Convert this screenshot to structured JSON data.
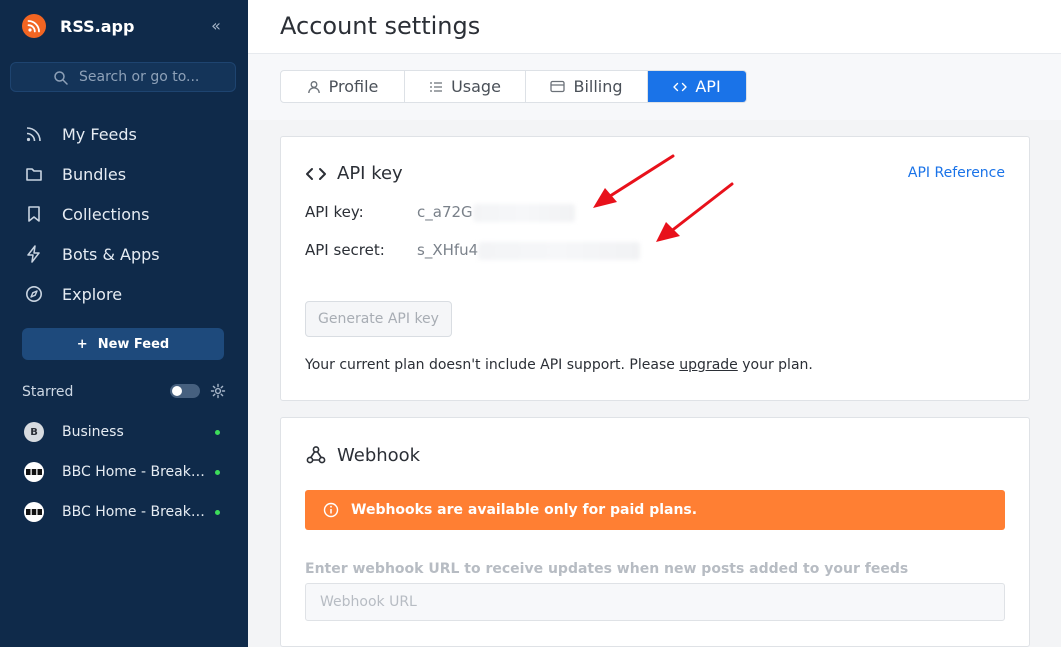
{
  "sidebar": {
    "brand": "RSS.app",
    "search_placeholder": "Search or go to...",
    "nav": [
      {
        "label": "My Feeds",
        "icon": "rss-icon"
      },
      {
        "label": "Bundles",
        "icon": "folder-icon"
      },
      {
        "label": "Collections",
        "icon": "bookmark-icon"
      },
      {
        "label": "Bots & Apps",
        "icon": "bolt-icon"
      },
      {
        "label": "Explore",
        "icon": "compass-icon"
      }
    ],
    "new_feed_label": "New Feed",
    "starred_label": "Starred",
    "feeds": [
      {
        "label": "Business",
        "avatar": "B"
      },
      {
        "label": "BBC Home - Breaking News",
        "avatar": "BBC"
      },
      {
        "label": "BBC Home - Breaking News",
        "avatar": "BBC"
      }
    ]
  },
  "header": {
    "title": "Account settings"
  },
  "tabs": [
    {
      "label": "Profile",
      "icon": "user-icon"
    },
    {
      "label": "Usage",
      "icon": "list-icon"
    },
    {
      "label": "Billing",
      "icon": "card-icon"
    },
    {
      "label": "API",
      "icon": "code-icon",
      "active": true
    }
  ],
  "api_card": {
    "title": "API key",
    "reference_link": "API Reference",
    "key_label": "API key:",
    "key_value": "c_a72G",
    "secret_label": "API secret:",
    "secret_value": "s_XHfu4",
    "generate_button": "Generate API key",
    "plan_note_before": "Your current plan doesn't include API support. Please ",
    "plan_note_link": "upgrade",
    "plan_note_after": " your plan."
  },
  "webhook_card": {
    "title": "Webhook",
    "alert": "Webhooks are available only for paid plans.",
    "input_label": "Enter webhook URL to receive updates when new posts added to your feeds",
    "input_placeholder": "Webhook URL"
  },
  "colors": {
    "sidebar_bg": "#0f2a4a",
    "accent": "#1a73e8",
    "alert": "#ff7f33",
    "brand": "#f26522",
    "annotation_arrow": "#e8111b"
  }
}
